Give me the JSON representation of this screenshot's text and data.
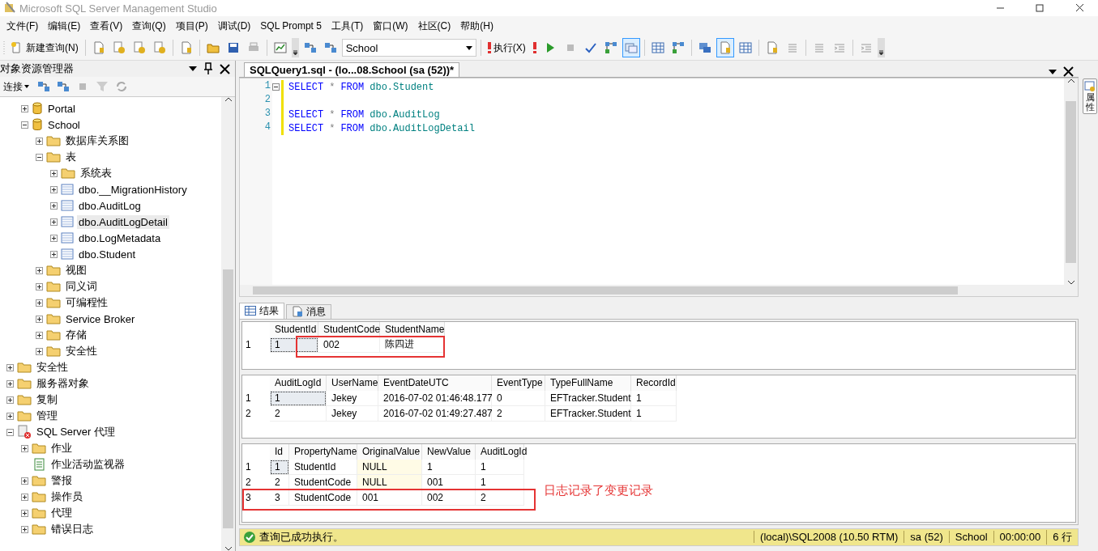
{
  "window": {
    "title": "Microsoft SQL Server Management Studio"
  },
  "menu": [
    {
      "label": "文件(F)"
    },
    {
      "label": "编辑(E)"
    },
    {
      "label": "查看(V)"
    },
    {
      "label": "查询(Q)"
    },
    {
      "label": "项目(P)"
    },
    {
      "label": "调试(D)"
    },
    {
      "label": "SQL Prompt 5"
    },
    {
      "label": "工具(T)"
    },
    {
      "label": "窗口(W)"
    },
    {
      "label": "社区(C)"
    },
    {
      "label": "帮助(H)"
    }
  ],
  "toolbar": [
    {
      "kind": "button",
      "label": "新建查询(N)"
    },
    {
      "kind": "sep"
    },
    {
      "kind": "icon",
      "pressed": false
    },
    {
      "kind": "icon",
      "pressed": false
    },
    {
      "kind": "icon",
      "pressed": false
    },
    {
      "kind": "icon",
      "pressed": false
    },
    {
      "kind": "sep"
    },
    {
      "kind": "icon",
      "pressed": false
    },
    {
      "kind": "sep"
    },
    {
      "kind": "icon",
      "pressed": false
    },
    {
      "kind": "icon",
      "pressed": false
    },
    {
      "kind": "icon",
      "pressed": false
    },
    {
      "kind": "sep"
    },
    {
      "kind": "icon",
      "pressed": false
    },
    {
      "kind": "more"
    },
    {
      "kind": "icon",
      "pressed": false
    },
    {
      "kind": "icon",
      "pressed": false
    },
    {
      "kind": "select",
      "value": "School"
    },
    {
      "kind": "sep"
    },
    {
      "kind": "button",
      "label": "执行(X)"
    },
    {
      "kind": "icon",
      "pressed": false
    },
    {
      "kind": "icon",
      "pressed": false
    },
    {
      "kind": "icon",
      "pressed": false
    },
    {
      "kind": "icon",
      "pressed": false
    },
    {
      "kind": "icon",
      "pressed": false
    },
    {
      "kind": "icon",
      "pressed": true
    },
    {
      "kind": "sep"
    },
    {
      "kind": "icon",
      "pressed": false
    },
    {
      "kind": "icon",
      "pressed": false
    },
    {
      "kind": "sep"
    },
    {
      "kind": "icon",
      "pressed": false
    },
    {
      "kind": "icon",
      "pressed": true
    },
    {
      "kind": "icon",
      "pressed": false
    },
    {
      "kind": "sep"
    },
    {
      "kind": "icon",
      "pressed": false
    },
    {
      "kind": "icon",
      "pressed": false
    },
    {
      "kind": "sep"
    },
    {
      "kind": "icon",
      "pressed": false
    },
    {
      "kind": "icon",
      "pressed": false
    },
    {
      "kind": "sep"
    },
    {
      "kind": "icon",
      "pressed": false
    },
    {
      "kind": "more"
    }
  ],
  "object_explorer": {
    "title": "对象资源管理器",
    "connect": "连接",
    "tree": [
      {
        "children": [
          {
            "label": "Portal",
            "kind": "database",
            "expanded": false,
            "selected": false
          },
          {
            "label": "School",
            "kind": "database",
            "expanded": true,
            "selected": false,
            "children": [
              {
                "label": "数据库关系图",
                "kind": "folder",
                "expanded": false,
                "selected": false
              },
              {
                "label": "表",
                "kind": "folder",
                "expanded": true,
                "selected": false,
                "children": [
                  {
                    "label": "系统表",
                    "kind": "folder",
                    "expanded": false,
                    "selected": false
                  },
                  {
                    "label": "dbo.__MigrationHistory",
                    "kind": "table",
                    "expanded": false,
                    "selected": false
                  },
                  {
                    "label": "dbo.AuditLog",
                    "kind": "table",
                    "expanded": false,
                    "selected": false
                  },
                  {
                    "label": "dbo.AuditLogDetail",
                    "kind": "table",
                    "expanded": false,
                    "selected": true
                  },
                  {
                    "label": "dbo.LogMetadata",
                    "kind": "table",
                    "expanded": false,
                    "selected": false
                  },
                  {
                    "label": "dbo.Student",
                    "kind": "table",
                    "expanded": false,
                    "selected": false
                  }
                ]
              },
              {
                "label": "视图",
                "kind": "folder",
                "expanded": false,
                "selected": false
              },
              {
                "label": "同义词",
                "kind": "folder",
                "expanded": false,
                "selected": false
              },
              {
                "label": "可编程性",
                "kind": "folder",
                "expanded": false,
                "selected": false
              },
              {
                "label": "Service Broker",
                "kind": "folder",
                "expanded": false,
                "selected": false
              },
              {
                "label": "存储",
                "kind": "folder",
                "expanded": false,
                "selected": false
              },
              {
                "label": "安全性",
                "kind": "folder",
                "expanded": false,
                "selected": false
              }
            ]
          }
        ]
      },
      {
        "label": "安全性",
        "kind": "folder",
        "expanded": false,
        "selected": false
      },
      {
        "label": "服务器对象",
        "kind": "folder",
        "expanded": false,
        "selected": false
      },
      {
        "label": "复制",
        "kind": "folder",
        "expanded": false,
        "selected": false
      },
      {
        "label": "管理",
        "kind": "folder",
        "expanded": false,
        "selected": false
      },
      {
        "label": "SQL Server 代理",
        "kind": "agent",
        "expanded": true,
        "selected": false,
        "children": [
          {
            "label": "作业",
            "kind": "folder",
            "expanded": false,
            "selected": false
          },
          {
            "label": "作业活动监视器",
            "kind": "monitor",
            "selected": false
          },
          {
            "label": "警报",
            "kind": "folder",
            "expanded": false,
            "selected": false
          },
          {
            "label": "操作员",
            "kind": "folder",
            "expanded": false,
            "selected": false
          },
          {
            "label": "代理",
            "kind": "folder",
            "expanded": false,
            "selected": false
          },
          {
            "label": "错误日志",
            "kind": "folder",
            "expanded": false,
            "selected": false
          }
        ]
      }
    ]
  },
  "editor": {
    "tab": "SQLQuery1.sql - (lo...08.School (sa (52))*",
    "lines": [
      {
        "number": "1",
        "fold": true,
        "tokens": [
          {
            "kind": "keyword",
            "text": "SELECT"
          },
          {
            "kind": "operator",
            "text": "*"
          },
          {
            "kind": "keyword",
            "text": "FROM"
          },
          {
            "kind": "name",
            "text": "dbo.Student"
          }
        ]
      },
      {
        "number": "2",
        "fold": false
      },
      {
        "number": "3",
        "fold": false,
        "tokens": [
          {
            "kind": "keyword",
            "text": "SELECT"
          },
          {
            "kind": "operator",
            "text": "*"
          },
          {
            "kind": "keyword",
            "text": "FROM"
          },
          {
            "kind": "name",
            "text": "dbo.AuditLog"
          }
        ]
      },
      {
        "number": "4",
        "fold": false,
        "tokens": [
          {
            "kind": "keyword",
            "text": "SELECT"
          },
          {
            "kind": "operator",
            "text": "*"
          },
          {
            "kind": "keyword",
            "text": "FROM"
          },
          {
            "kind": "name",
            "text": "dbo.AuditLogDetail"
          }
        ]
      }
    ]
  },
  "results": {
    "tabs": [
      {
        "label": "结果",
        "selected": true
      },
      {
        "label": "消息",
        "selected": false
      }
    ],
    "grids": [
      {
        "columns": [
          "StudentId",
          "StudentCode",
          "StudentName"
        ],
        "rows": [
          {
            "number": "1",
            "outlined": true,
            "cells": [
              {
                "text": "1",
                "null": false,
                "selected": true
              },
              {
                "text": "002",
                "null": false,
                "selected": false
              },
              {
                "text": "陈四进",
                "null": false,
                "selected": false
              }
            ]
          }
        ]
      },
      {
        "columns": [
          "AuditLogId",
          "UserName",
          "EventDateUTC",
          "EventType",
          "TypeFullName",
          "RecordId"
        ],
        "rows": [
          {
            "number": "1",
            "outlined": false,
            "cells": [
              {
                "text": "1",
                "null": false,
                "selected": true
              },
              {
                "text": "Jekey",
                "null": false,
                "selected": false
              },
              {
                "text": "2016-07-02 01:46:48.177",
                "null": false,
                "selected": false
              },
              {
                "text": "0",
                "null": false,
                "selected": false
              },
              {
                "text": "EFTracker.Student",
                "null": false,
                "selected": false
              },
              {
                "text": "1",
                "null": false,
                "selected": false
              }
            ]
          },
          {
            "number": "2",
            "outlined": false,
            "cells": [
              {
                "text": "2",
                "null": false,
                "selected": false
              },
              {
                "text": "Jekey",
                "null": false,
                "selected": false
              },
              {
                "text": "2016-07-02 01:49:27.487",
                "null": false,
                "selected": false
              },
              {
                "text": "2",
                "null": false,
                "selected": false
              },
              {
                "text": "EFTracker.Student",
                "null": false,
                "selected": false
              },
              {
                "text": "1",
                "null": false,
                "selected": false
              }
            ]
          }
        ]
      },
      {
        "columns": [
          "Id",
          "PropertyName",
          "OriginalValue",
          "NewValue",
          "AuditLogId"
        ],
        "note": "日志记录了变更记录",
        "rows": [
          {
            "number": "1",
            "outlined": false,
            "cells": [
              {
                "text": "1",
                "null": false,
                "selected": true
              },
              {
                "text": "StudentId",
                "null": false,
                "selected": false
              },
              {
                "text": "NULL",
                "null": true,
                "selected": false
              },
              {
                "text": "1",
                "null": false,
                "selected": false
              },
              {
                "text": "1",
                "null": false,
                "selected": false
              }
            ]
          },
          {
            "number": "2",
            "outlined": false,
            "cells": [
              {
                "text": "2",
                "null": false,
                "selected": false
              },
              {
                "text": "StudentCode",
                "null": false,
                "selected": false
              },
              {
                "text": "NULL",
                "null": true,
                "selected": false
              },
              {
                "text": "001",
                "null": false,
                "selected": false
              },
              {
                "text": "1",
                "null": false,
                "selected": false
              }
            ]
          },
          {
            "number": "3",
            "outlined": true,
            "cells": [
              {
                "text": "3",
                "null": false,
                "selected": false
              },
              {
                "text": "StudentCode",
                "null": false,
                "selected": false
              },
              {
                "text": "001",
                "null": false,
                "selected": false
              },
              {
                "text": "002",
                "null": false,
                "selected": false
              },
              {
                "text": "2",
                "null": false,
                "selected": false
              }
            ]
          }
        ]
      }
    ]
  },
  "status_bar": {
    "message": "查询已成功执行。",
    "sections": [
      "(local)\\SQL2008 (10.50 RTM)",
      "sa (52)",
      "School",
      "00:00:00",
      "6 行"
    ]
  },
  "side_tab": {
    "label": "属性"
  }
}
